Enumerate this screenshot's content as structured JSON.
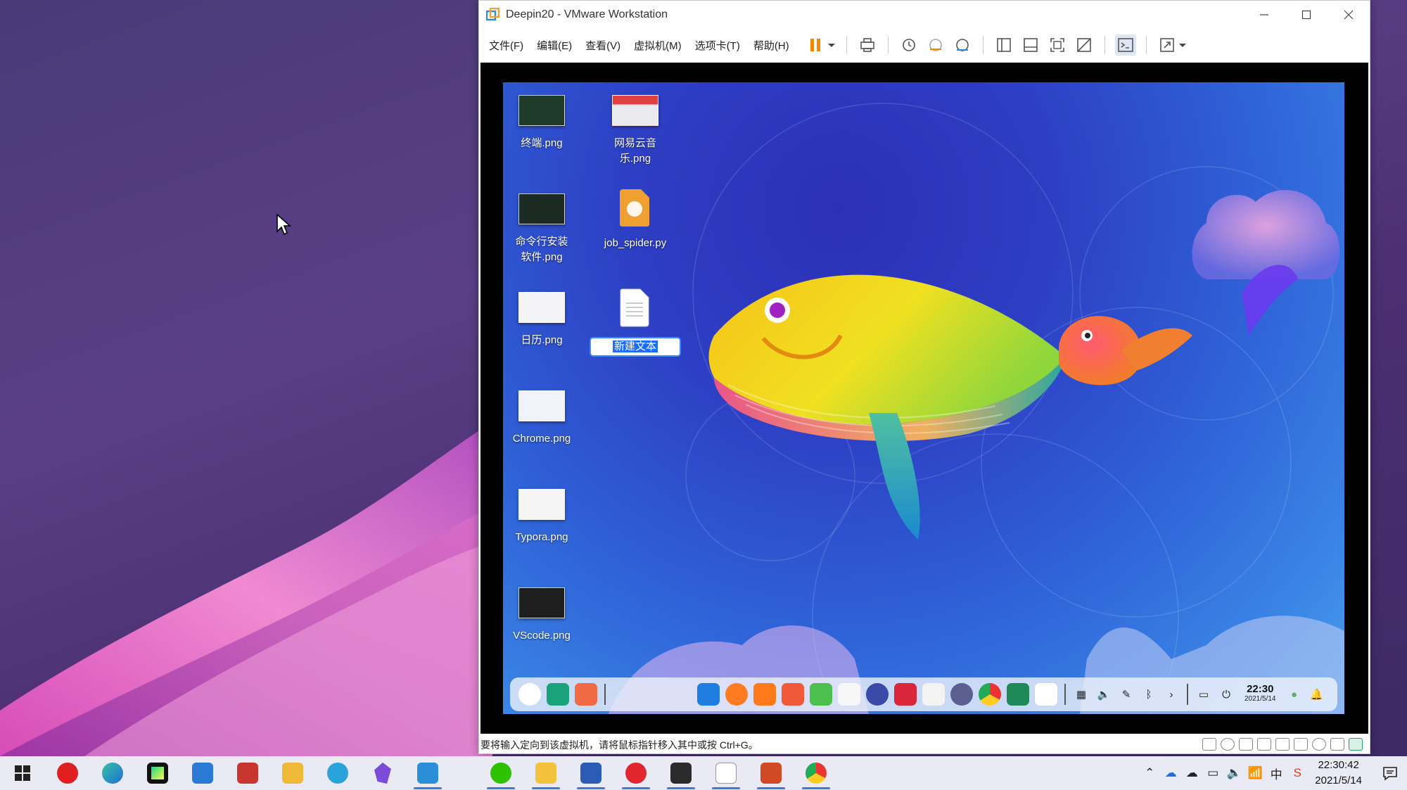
{
  "vmware": {
    "title": "Deepin20 - VMware Workstation",
    "menu": [
      "文件(F)",
      "编辑(E)",
      "查看(V)",
      "虚拟机(M)",
      "选项卡(T)",
      "帮助(H)"
    ],
    "toolbar_icons": [
      "pause-icon",
      "dropdown-icon",
      "send-ctrl-alt-del-icon",
      "snapshot-icon",
      "revert-snapshot-icon",
      "snapshot-manager-icon",
      "library-view-icon",
      "thumbnail-view-icon",
      "fullscreen-icon",
      "unity-icon",
      "console-icon",
      "stretch-icon",
      "dropdown-icon"
    ],
    "status_text": "要将输入定向到该虚拟机，请将鼠标指针移入其中或按 Ctrl+G。"
  },
  "guest": {
    "desktop_icons": [
      {
        "label": "终端.png",
        "thumb": "#1e3b2a"
      },
      {
        "label": "网易云音乐.png",
        "thumb": "#e9e9ee"
      },
      {
        "label": "命令行安装软件.png",
        "thumb": "#1b2a22"
      },
      {
        "label": "job_spider.py",
        "thumb": "#f0a030"
      },
      {
        "label": "日历.png",
        "thumb": "#f4f4f6"
      },
      {
        "label": "新建文本",
        "thumb": "#ffffff"
      },
      {
        "label": "Chrome.png",
        "thumb": "#f1f3fb"
      },
      {
        "label": "Typora.png",
        "thumb": "#f5f5f5"
      },
      {
        "label": "VScode.png",
        "thumb": "#1e1e1e"
      }
    ],
    "dock": {
      "apps": [
        {
          "name": "launcher",
          "color": "#ffffff"
        },
        {
          "name": "multitask-view",
          "color": "#1aa37a"
        },
        {
          "name": "app-store",
          "color": "#f06a43"
        },
        {
          "name": "file-manager",
          "color": "#1e7fe0"
        },
        {
          "name": "firefox",
          "color": "#ff7b22"
        },
        {
          "name": "deepin-store",
          "color": "#ff7a1a"
        },
        {
          "name": "image-viewer",
          "color": "#f05a3a"
        },
        {
          "name": "music",
          "color": "#4cc04c"
        },
        {
          "name": "calendar",
          "color": "#f7f7f7"
        },
        {
          "name": "control-center",
          "color": "#3a4aa8"
        },
        {
          "name": "terminal",
          "color": "#d8263b"
        },
        {
          "name": "text-editor",
          "color": "#f3f3f3"
        },
        {
          "name": "camera",
          "color": "#5b5e8e"
        },
        {
          "name": "chrome",
          "color": "#ffffff"
        },
        {
          "name": "installer",
          "color": "#1e8a5a"
        },
        {
          "name": "typora",
          "color": "#ffffff"
        }
      ],
      "time": "22:30",
      "date": "2021/5/14"
    }
  },
  "taskbar": {
    "apps": [
      {
        "name": "start",
        "color": "#222222"
      },
      {
        "name": "huawei-pc-manager",
        "color": "#e02020"
      },
      {
        "name": "edge",
        "color": "#1f8ad2"
      },
      {
        "name": "pycharm",
        "color": "#21d789"
      },
      {
        "name": "vscode",
        "color": "#2a7ad6"
      },
      {
        "name": "zotero",
        "color": "#c8372d"
      },
      {
        "name": "file-explorer-yellow",
        "color": "#f1b93a"
      },
      {
        "name": "telegram",
        "color": "#2aa3dd"
      },
      {
        "name": "obsidian",
        "color": "#7a4cd8"
      },
      {
        "name": "vmware",
        "color": "#2a8fd8"
      },
      {
        "name": "wechat",
        "color": "#2dc100"
      },
      {
        "name": "file-explorer",
        "color": "#f3c23c"
      },
      {
        "name": "word",
        "color": "#2b5bb5"
      },
      {
        "name": "netease-music",
        "color": "#e0262f"
      },
      {
        "name": "terminal",
        "color": "#2b2b2b"
      },
      {
        "name": "typora",
        "color": "#ffffff"
      },
      {
        "name": "powerpoint",
        "color": "#d04a26"
      },
      {
        "name": "chrome",
        "color": "#ffffff"
      }
    ],
    "time": "22:30:42",
    "date": "2021/5/14"
  }
}
